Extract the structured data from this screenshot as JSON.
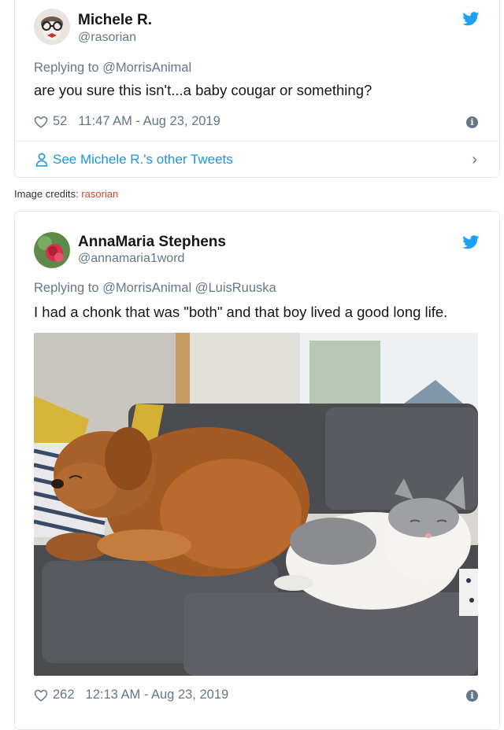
{
  "tweet1": {
    "name": "Michele R.",
    "handle": "@rasorian",
    "replying_to": "Replying to @MorrisAnimal",
    "text": "are you sure this isn't...a baby cougar or something?",
    "likes": "52",
    "timestamp": "11:47 AM - Aug 23, 2019",
    "see_more": "See Michele R.'s other Tweets"
  },
  "credit": {
    "label": "Image credits:",
    "link": "rasorian"
  },
  "tweet2": {
    "name": "AnnaMaria Stephens",
    "handle": "@annamaria1word",
    "replying_to": "Replying to @MorrisAnimal @LuisRuuska",
    "text": "I had a chonk that was \"both\" and that boy lived a good long life.",
    "likes": "262",
    "timestamp": "12:13 AM - Aug 23, 2019"
  },
  "colors": {
    "twitter_blue": "#1da1f2",
    "link_blue": "#1b95e0",
    "muted": "#657786",
    "credit_red": "#d9432f"
  },
  "icons": [
    "avatar",
    "twitter-bird-icon",
    "heart-icon",
    "info-icon",
    "person-icon",
    "chevron-right-icon"
  ]
}
